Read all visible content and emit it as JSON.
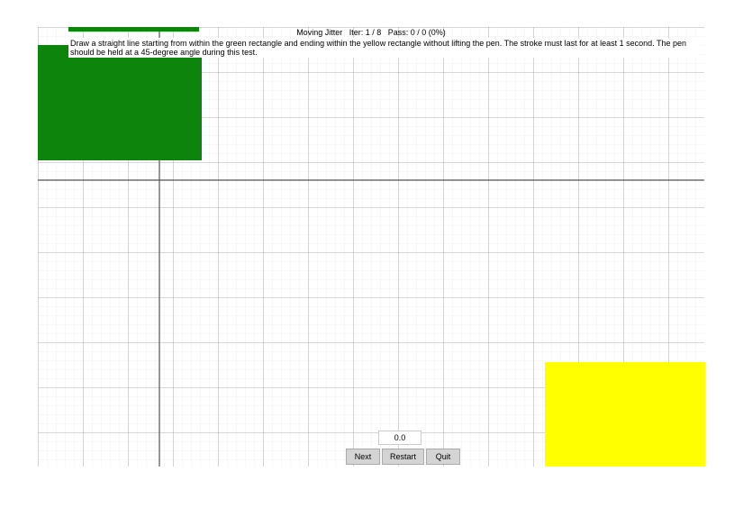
{
  "header": {
    "title": "Moving Jitter",
    "iter_label": "Iter: 1 / 8",
    "pass_label": "Pass: 0 / 0 (0%)"
  },
  "instruction": "Draw a straight line starting from within the green rectangle and ending within the yellow rectangle without lifting the pen. The stroke must last for at least 1 second. The pen should be held at a 45-degree angle during this test.",
  "value_display": "0.0",
  "buttons": {
    "next": "Next",
    "restart": "Restart",
    "quit": "Quit"
  },
  "grid": {
    "minor_spacing": 10,
    "major_spacing": 50,
    "minor_color": "#e5e5e5",
    "major_color": "#999999"
  },
  "rects": {
    "green_color": "#0d850d",
    "yellow_color": "#ffff00"
  }
}
